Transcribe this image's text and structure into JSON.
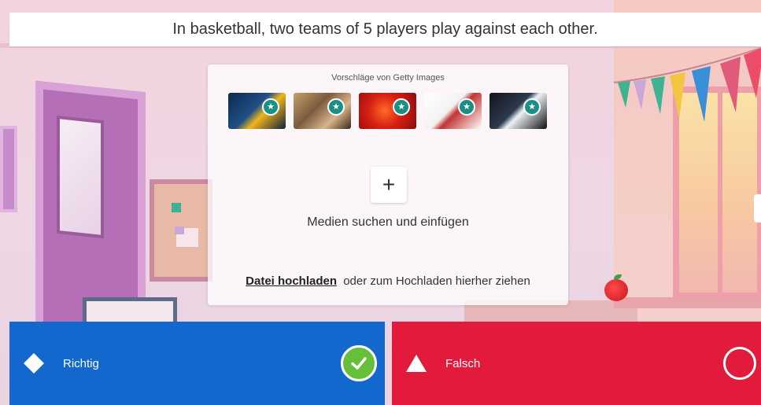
{
  "question": {
    "text": "In basketball, two teams of 5 players play against each other."
  },
  "media_panel": {
    "getty_label": "Vorschläge von Getty Images",
    "thumbnails": [
      {
        "icon": "star-icon"
      },
      {
        "icon": "star-icon"
      },
      {
        "icon": "star-icon"
      },
      {
        "icon": "star-icon"
      },
      {
        "icon": "star-icon"
      }
    ],
    "plus_label": "+",
    "search_label": "Medien suchen und einfügen",
    "upload_link": "Datei hochladen",
    "upload_text": "oder zum Hochladen hierher ziehen"
  },
  "answers": [
    {
      "label": "Richtig",
      "shape": "diamond-icon",
      "color": "#1368ce",
      "correct": true
    },
    {
      "label": "Falsch",
      "shape": "triangle-icon",
      "color": "#e21b3c",
      "correct": false
    }
  ],
  "colors": {
    "correct_check": "#66bf39",
    "getty_badge": "#1a8f86"
  }
}
